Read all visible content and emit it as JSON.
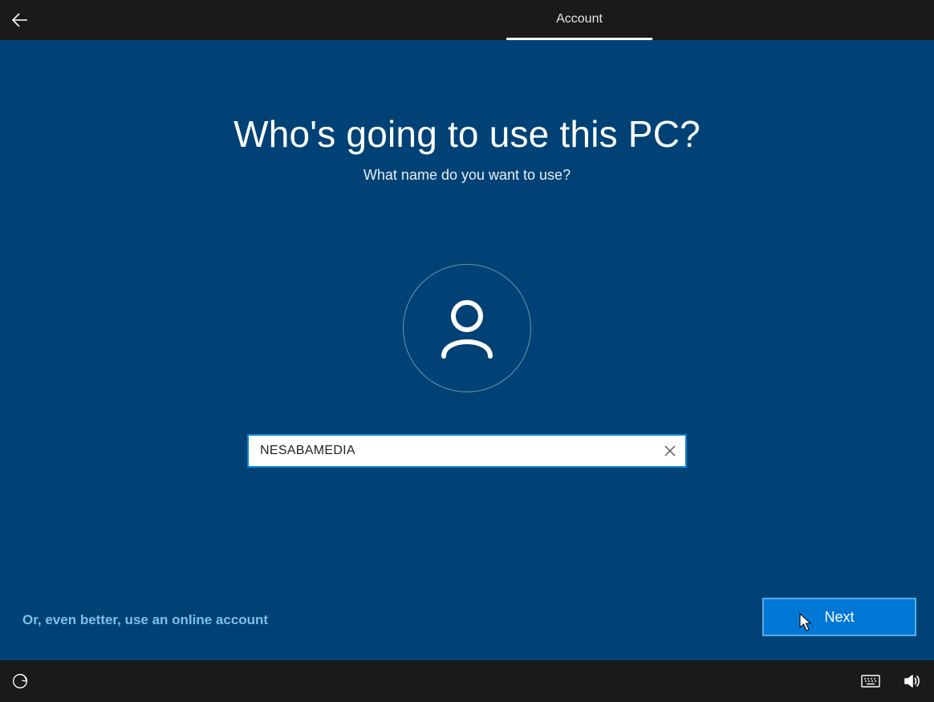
{
  "header": {
    "tab_label": "Account"
  },
  "main": {
    "heading": "Who's going to use this PC?",
    "subheading": "What name do you want to use?",
    "name_value": "NESABAMEDIA",
    "online_account_link": "Or, even better, use an online account",
    "next_button": "Next"
  },
  "icons": {
    "back": "back-arrow-icon",
    "avatar": "user-avatar-icon",
    "clear": "clear-x-icon",
    "ease_of_access": "ease-of-access-icon",
    "keyboard": "keyboard-icon",
    "volume": "volume-icon"
  },
  "colors": {
    "background": "#004275",
    "accent": "#0178d6",
    "bar": "#1a1a1a",
    "link": "#7fbfe8"
  }
}
